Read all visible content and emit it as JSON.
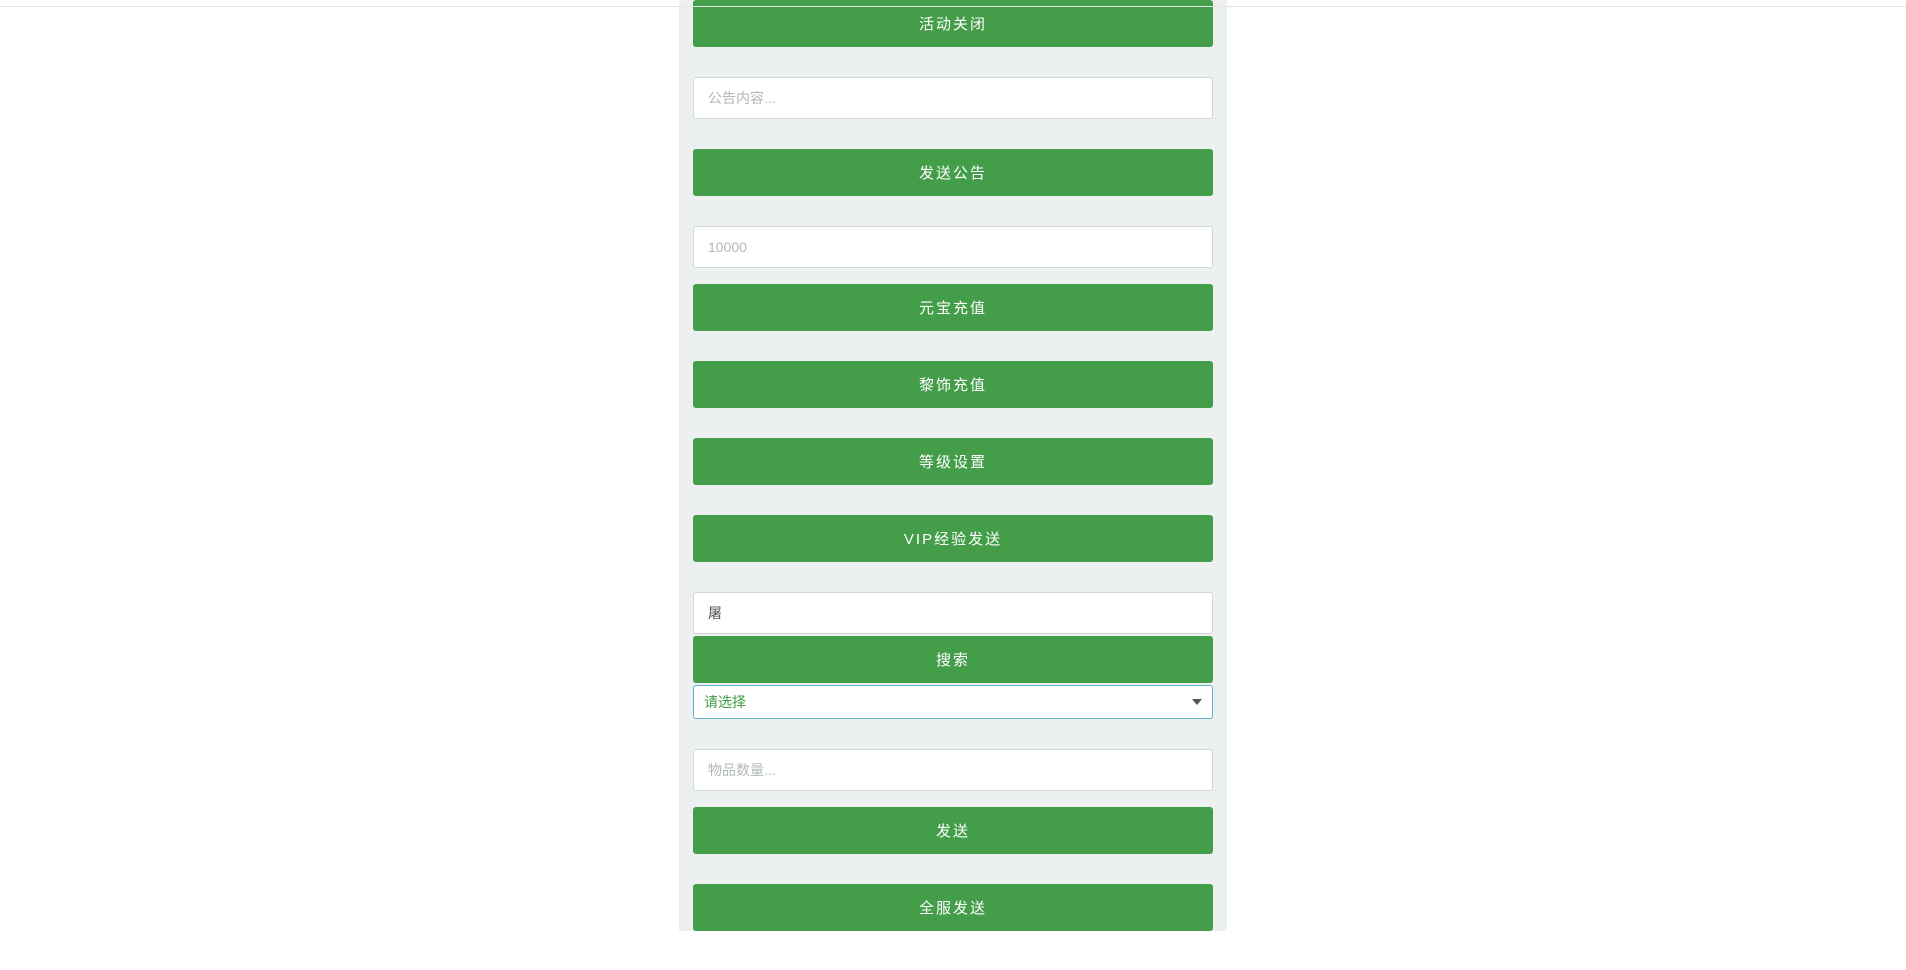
{
  "buttons": {
    "activity_close": "活动关闭",
    "send_announcement": "发送公告",
    "yuanbao_recharge": "元宝充值",
    "decoration_recharge": "黎饰充值",
    "level_setting": "等级设置",
    "vip_exp_send": "VIP经验发送",
    "search": "搜索",
    "send": "发送",
    "send_all_server": "全服发送"
  },
  "inputs": {
    "announcement_placeholder": "公告内容...",
    "amount_placeholder": "10000",
    "search_value": "屠",
    "item_quantity_placeholder": "物品数量..."
  },
  "select": {
    "placeholder_option": "请选择"
  }
}
